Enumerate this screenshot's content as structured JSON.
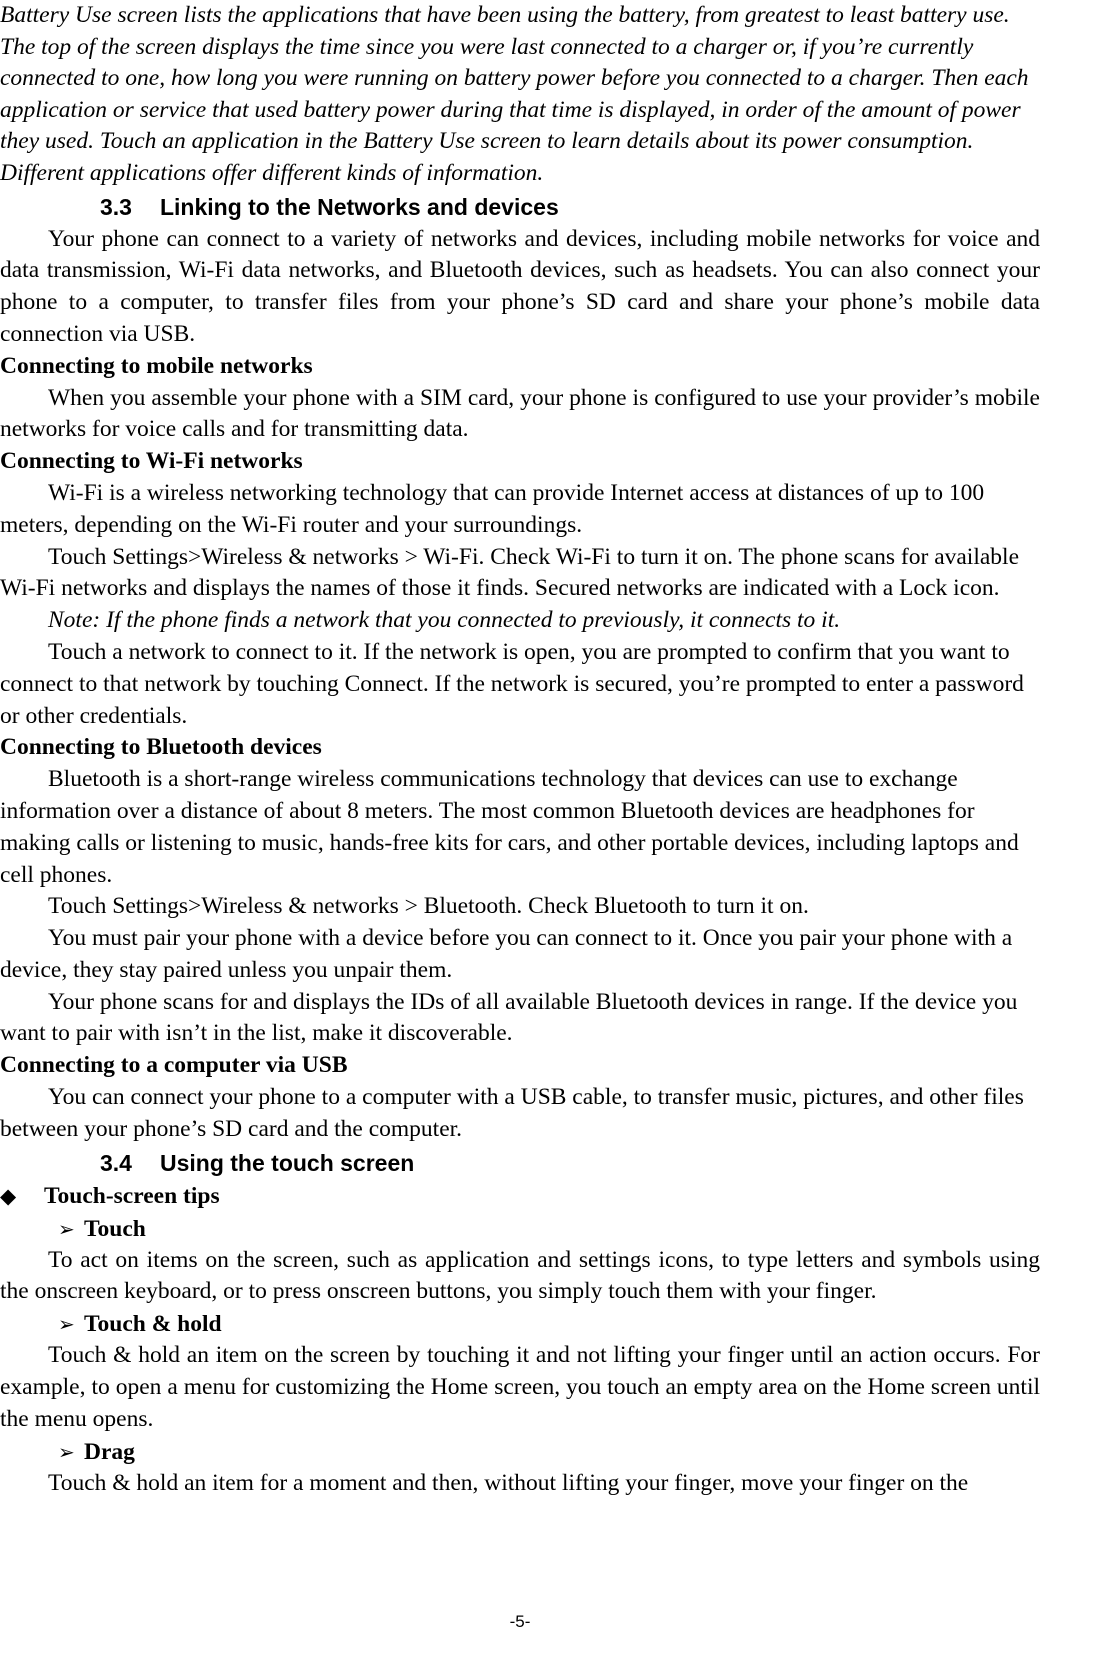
{
  "document": {
    "page_number": "-5-",
    "intro_paragraph": "Battery Use screen lists the applications that have been using the battery, from greatest to least battery use. The top of the screen displays the time since you were last connected to a charger or, if you’re currently connected to one, how long you were running on battery power before you connected to a charger. Then each application or service that used battery power during that time is displayed, in order of the amount of power they used. Touch an application in the Battery Use screen to learn details about its power consumption. Different applications offer different kinds of information.",
    "sections": [
      {
        "number": "3.3",
        "title": "Linking to the Networks and devices",
        "intro": "Your phone can connect to a variety of networks and devices, including mobile networks for voice and data transmission, Wi-Fi data networks, and Bluetooth devices, such as headsets. You can also connect your phone to a computer, to transfer files from your phone’s SD card and share your phone’s mobile data connection via USB.",
        "subsections": [
          {
            "heading": "Connecting to mobile networks",
            "paragraphs": [
              "When you assemble your phone with a SIM card, your phone is configured to use your provider’s mobile networks for voice calls and for transmitting data."
            ]
          },
          {
            "heading": "Connecting to Wi-Fi networks",
            "paragraphs": [
              "Wi-Fi is a wireless networking technology that can provide Internet access at distances of up to 100 meters, depending on the Wi-Fi router and your surroundings.",
              "Touch Settings>Wireless & networks > Wi-Fi. Check Wi-Fi to turn it on. The phone scans for available Wi-Fi networks and displays the names of those it finds. Secured networks are indicated with a Lock icon.",
              "Note: If the phone finds a network that you connected to previously, it connects to it.",
              "Touch a network to connect to it. If the network is open, you are prompted to confirm that you want to connect to that network by touching Connect. If the network is secured, you’re prompted to enter a password or other credentials."
            ]
          },
          {
            "heading": "Connecting to Bluetooth devices",
            "paragraphs": [
              "Bluetooth is a short-range wireless communications technology that devices can use to exchange information over a distance of about 8 meters. The most common Bluetooth devices are headphones for making calls or listening to music, hands-free kits for cars, and other portable devices, including laptops and cell phones.",
              "Touch Settings>Wireless & networks > Bluetooth. Check Bluetooth to turn it on.",
              "You must pair your phone with a device before you can connect to it. Once you pair your phone with a device, they stay paired unless you unpair them.",
              "Your phone scans for and displays the IDs of all available Bluetooth devices in range. If the device you want to pair with isn’t in the list, make it discoverable."
            ]
          },
          {
            "heading": "Connecting to a computer via USB",
            "paragraphs": [
              "You can connect your phone to a computer with a USB cable, to transfer music, pictures, and other files between your phone’s SD card and the computer."
            ]
          }
        ]
      },
      {
        "number": "3.4",
        "title": "Using the touch screen",
        "bullet_group": {
          "marker": "diamond-bullet",
          "marker_glyph": "◆",
          "label": "Touch-screen tips",
          "items": [
            {
              "marker": "arrow-bullet",
              "marker_glyph": "➢",
              "label": "Touch",
              "body": "To act on items on the screen, such as application and settings icons, to type letters and symbols using the onscreen keyboard, or to press onscreen buttons, you simply touch them with your finger."
            },
            {
              "marker": "arrow-bullet",
              "marker_glyph": "➢",
              "label": "Touch & hold",
              "body": "Touch & hold an item on the screen by touching it and not lifting your finger until an action occurs. For example, to open a menu for customizing the Home screen, you touch an empty area on the Home screen until the menu opens."
            },
            {
              "marker": "arrow-bullet",
              "marker_glyph": "➢",
              "label": "Drag",
              "body": "Touch & hold an item for a moment and then, without lifting your finger, move your finger on the"
            }
          ]
        }
      }
    ]
  }
}
